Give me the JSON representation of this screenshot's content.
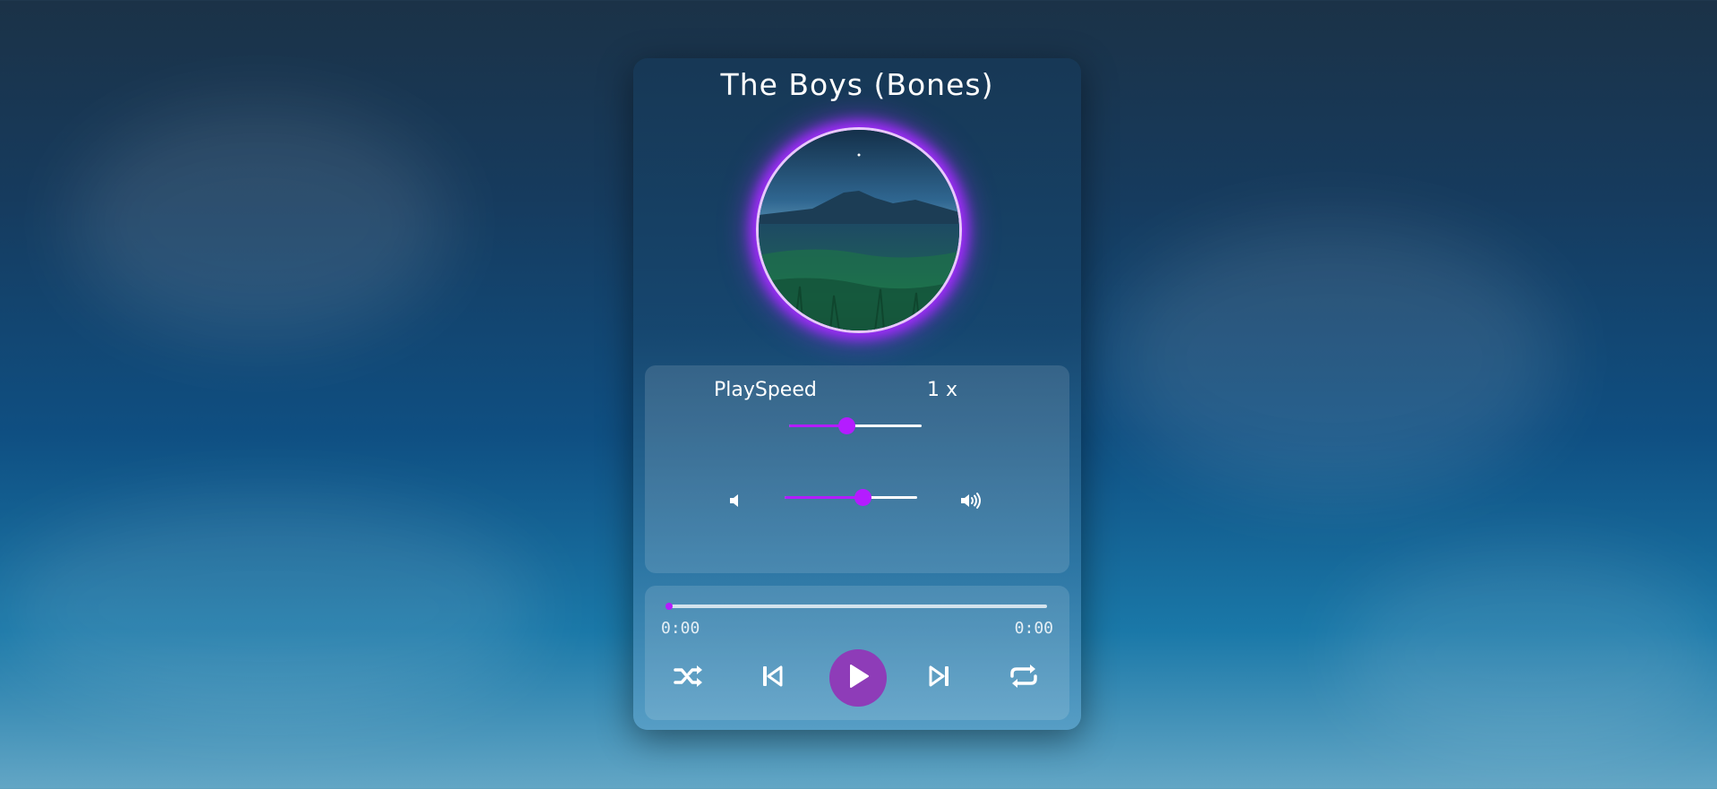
{
  "song": {
    "title": "The Boys (Bones)"
  },
  "speed": {
    "label": "PlaySpeed",
    "value_text": "1 x",
    "level": 0.43
  },
  "volume": {
    "level": 0.59,
    "mute_icon": "volume-low-icon",
    "loud_icon": "volume-high-icon"
  },
  "progress": {
    "fraction": 0.0,
    "current_time": "0:00",
    "total_time": "0:00"
  },
  "controls": {
    "shuffle_icon": "shuffle-icon",
    "prev_icon": "skip-back-icon",
    "play_icon": "play-icon",
    "next_icon": "skip-forward-icon",
    "repeat_icon": "repeat-icon"
  },
  "colors": {
    "accent": "#b41cff",
    "play_button": "#8e3cb8",
    "glow": "#a42bff"
  }
}
